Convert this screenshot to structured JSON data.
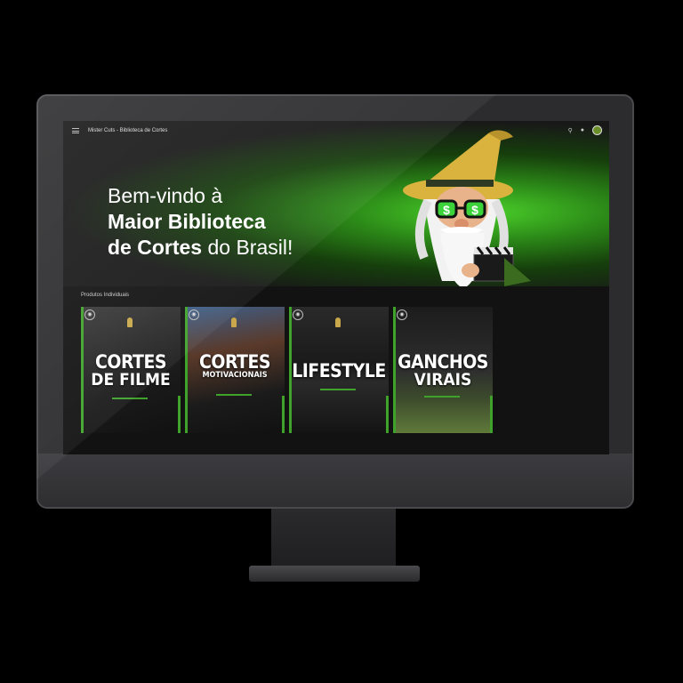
{
  "header": {
    "title": "Mister Cuts - Biblioteca de Cortes"
  },
  "hero": {
    "line1": "Bem-vindo à",
    "line2": "Maior Biblioteca",
    "line3_bold": "de Cortes",
    "line3_rest": " do Brasil!"
  },
  "section": {
    "label": "Produtos Individuais",
    "cards": [
      {
        "title": "CORTES",
        "subtitle": "DE FILME"
      },
      {
        "title": "CORTES",
        "subtitle": "MOTIVACIONAIS"
      },
      {
        "title": "LIFESTYLE",
        "subtitle": ""
      },
      {
        "title": "GANCHOS",
        "subtitle": "VIRAIS"
      }
    ]
  },
  "icons": [
    "menu-icon",
    "search-icon",
    "bell-icon",
    "avatar",
    "lock-icon"
  ],
  "colors": {
    "accent": "#3fa32b",
    "hero_glow": "#4bd12a",
    "background": "#141414"
  }
}
